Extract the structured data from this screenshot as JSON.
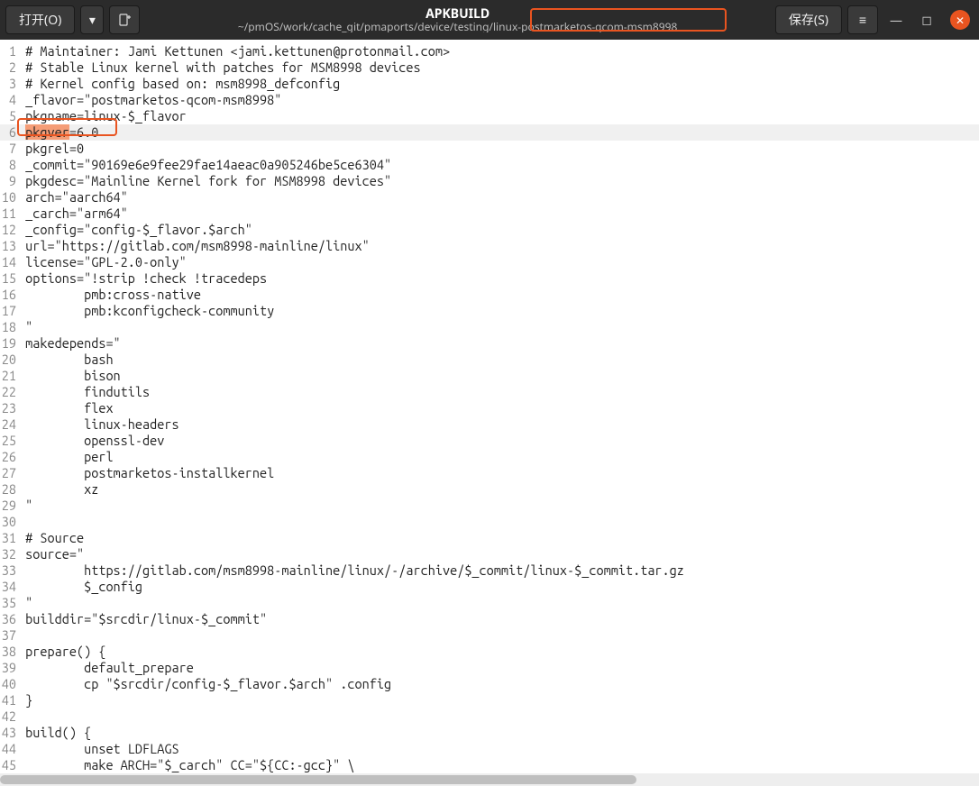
{
  "titlebar": {
    "open_label": "打开(O)",
    "save_label": "保存(S)",
    "title": "APKBUILD",
    "subtitle_prefix": "~/pmOS/work/cache_git/pmaports/device/testing/",
    "subtitle_suffix": "linux-postmarketos-qcom-msm8998"
  },
  "highlighted_token": "pkgver",
  "code_lines": [
    "# Maintainer: Jami Kettunen <jami.kettunen@protonmail.com>",
    "# Stable Linux kernel with patches for MSM8998 devices",
    "# Kernel config based on: msm8998_defconfig",
    "_flavor=\"postmarketos-qcom-msm8998\"",
    "pkgname=linux-$_flavor",
    "pkgver=6.0",
    "pkgrel=0",
    "_commit=\"90169e6e9fee29fae14aeac0a905246be5ce6304\"",
    "pkgdesc=\"Mainline Kernel fork for MSM8998 devices\"",
    "arch=\"aarch64\"",
    "_carch=\"arm64\"",
    "_config=\"config-$_flavor.$arch\"",
    "url=\"https://gitlab.com/msm8998-mainline/linux\"",
    "license=\"GPL-2.0-only\"",
    "options=\"!strip !check !tracedeps",
    "        pmb:cross-native",
    "        pmb:kconfigcheck-community",
    "\"",
    "makedepends=\"",
    "        bash",
    "        bison",
    "        findutils",
    "        flex",
    "        linux-headers",
    "        openssl-dev",
    "        perl",
    "        postmarketos-installkernel",
    "        xz",
    "\"",
    "",
    "# Source",
    "source=\"",
    "        https://gitlab.com/msm8998-mainline/linux/-/archive/$_commit/linux-$_commit.tar.gz",
    "        $_config",
    "\"",
    "builddir=\"$srcdir/linux-$_commit\"",
    "",
    "prepare() {",
    "        default_prepare",
    "        cp \"$srcdir/config-$_flavor.$arch\" .config",
    "}",
    "",
    "build() {",
    "        unset LDFLAGS",
    "        make ARCH=\"$_carch\" CC=\"${CC:-gcc}\" \\"
  ]
}
